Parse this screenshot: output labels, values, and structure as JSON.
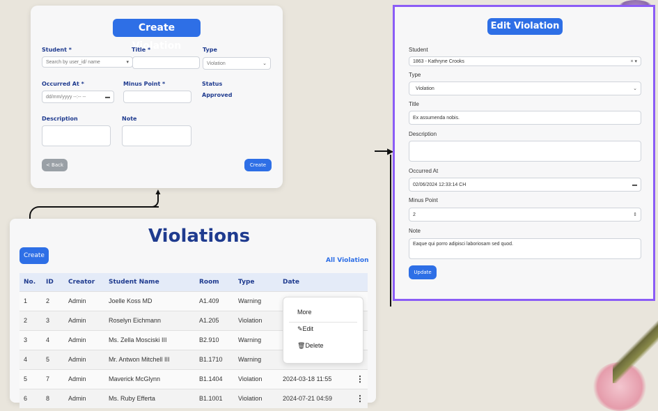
{
  "create_form": {
    "title": "Create Violation",
    "student_label": "Student *",
    "student_placeholder": "Search by user_id/ name",
    "title_label": "Title *",
    "type_label": "Type",
    "type_value": "Violation",
    "occurred_label": "Occurred At *",
    "occurred_placeholder": "dd/mm/yyyy --:-- --",
    "minus_label": "Minus Point *",
    "status_label": "Status",
    "status_value": "Approved",
    "description_label": "Description",
    "note_label": "Note",
    "back_label": "< Back",
    "create_label": "Create"
  },
  "list_page": {
    "title": "Violations",
    "create_label": "Create",
    "filter_label": "All Violation",
    "columns": [
      "No.",
      "ID",
      "Creator",
      "Student Name",
      "Room",
      "Type",
      "Date"
    ],
    "rows": [
      {
        "no": "1",
        "id": "2",
        "creator": "Admin",
        "name": "Joelle Koss MD",
        "room": "A1.409",
        "type": "Warning",
        "date": ""
      },
      {
        "no": "2",
        "id": "3",
        "creator": "Admin",
        "name": "Roselyn Eichmann",
        "room": "A1.205",
        "type": "Violation",
        "date": ""
      },
      {
        "no": "3",
        "id": "4",
        "creator": "Admin",
        "name": "Ms. Zella Mosciski III",
        "room": "B2.910",
        "type": "Warning",
        "date": ""
      },
      {
        "no": "4",
        "id": "5",
        "creator": "Admin",
        "name": "Mr. Antwon Mitchell III",
        "room": "B1.1710",
        "type": "Warning",
        "date": ""
      },
      {
        "no": "5",
        "id": "7",
        "creator": "Admin",
        "name": "Maverick McGlynn",
        "room": "B1.1404",
        "type": "Violation",
        "date": "2024-03-18 11:55"
      },
      {
        "no": "6",
        "id": "8",
        "creator": "Admin",
        "name": "Ms. Ruby Efferta",
        "room": "B1.1001",
        "type": "Violation",
        "date": "2024-07-21 04:59"
      }
    ],
    "menu": {
      "more": "More",
      "edit": "Edit",
      "delete": "Delete"
    }
  },
  "edit_form": {
    "title": "Edit Violation",
    "student_label": "Student",
    "student_value": "1863 - Kathryne Crooks",
    "type_label": "Type",
    "type_value": "Violation",
    "title_label": "Title",
    "title_value": "Ex assumenda nobis.",
    "description_label": "Description",
    "occurred_label": "Occurred At",
    "occurred_value": "02/06/2024 12:33:14 CH",
    "minus_label": "Minus Point",
    "minus_value": "2",
    "note_label": "Note",
    "note_value": "Eaque qui porro adipisci laboriosam sed quod.",
    "update_label": "Update"
  },
  "colors": {
    "accent": "#2e6fe6",
    "purple_border": "#8b5cf6",
    "heading": "#1f3b8f"
  }
}
